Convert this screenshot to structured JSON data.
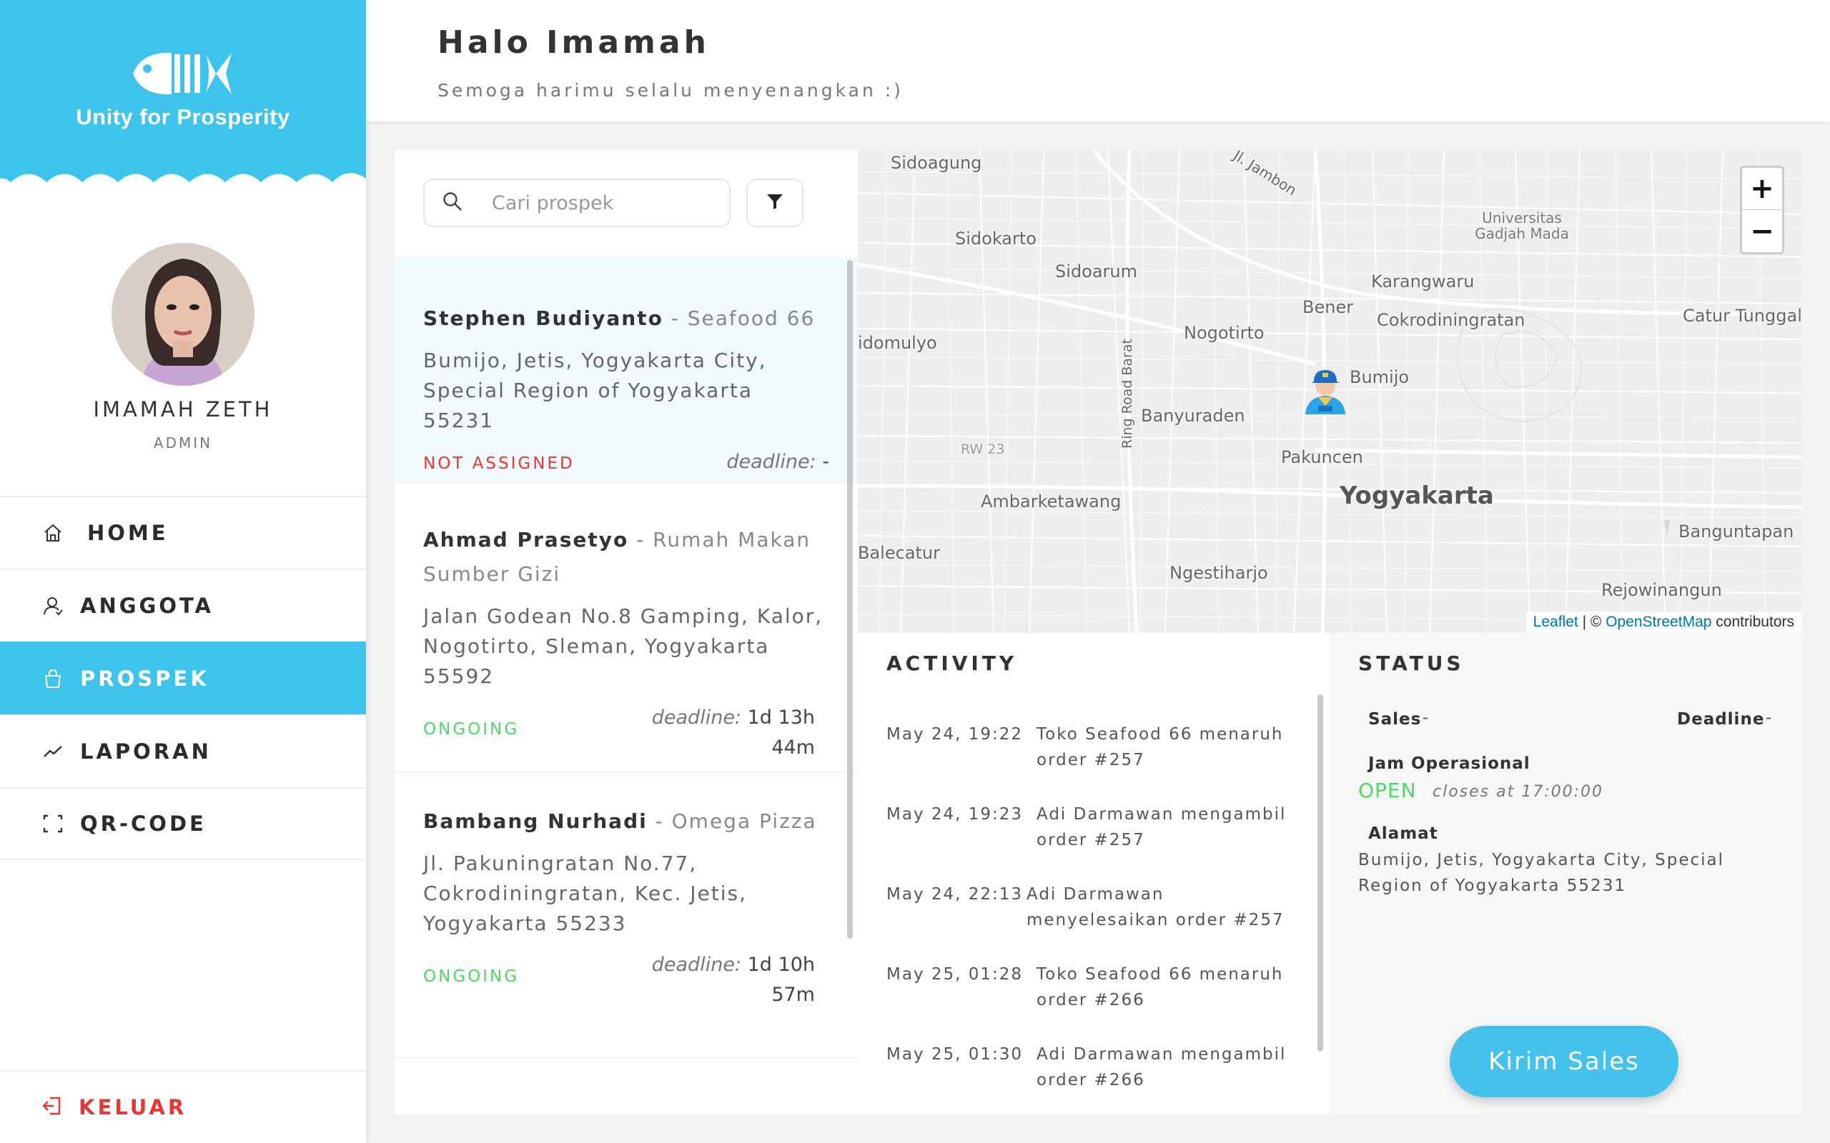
{
  "brand": {
    "name": "Unity for Prosperity",
    "logo_icon": "fish-icon",
    "color": "#3ec4ec"
  },
  "profile": {
    "name": "IMAMAH ZETH",
    "role": "ADMIN"
  },
  "nav": [
    {
      "label": "HOME",
      "icon": "home-icon",
      "active": false
    },
    {
      "label": "ANGGOTA",
      "icon": "user-icon",
      "active": false
    },
    {
      "label": "PROSPEK",
      "icon": "bag-icon",
      "active": true
    },
    {
      "label": "LAPORAN",
      "icon": "chart-icon",
      "active": false
    },
    {
      "label": "QR-CODE",
      "icon": "qr-scan-icon",
      "active": false
    }
  ],
  "logout": {
    "label": "KELUAR",
    "icon": "logout-icon",
    "color": "#e53935"
  },
  "header": {
    "greeting": "Halo Imamah",
    "subtitle": "Semoga harimu selalu menyenangkan :)"
  },
  "search": {
    "placeholder": "Cari prospek",
    "value": ""
  },
  "prospects": [
    {
      "name": "Stephen Budiyanto",
      "separator": "-",
      "business": "Seafood 66",
      "address": "Bumijo, Jetis, Yogyakarta City, Special Region of Yogyakarta 55231",
      "status": "NOT ASSIGNED",
      "deadline_label": "deadline:",
      "deadline_value": "-"
    },
    {
      "name": "Ahmad Prasetyo",
      "separator": "-",
      "business": "Rumah Makan Sumber Gizi",
      "address": "Jalan Godean No.8 Gamping, Kalor, Nogotirto, Sleman, Yogyakarta 55592",
      "status": "ONGOING",
      "deadline_label": "deadline:",
      "deadline_value": "1d 13h 44m"
    },
    {
      "name": "Bambang Nurhadi",
      "separator": "-",
      "business": "Omega Pizza",
      "address": "Jl. Pakuningratan No.77, Cokrodiningratan, Kec. Jetis, Yogyakarta 55233",
      "status": "ONGOING",
      "deadline_label": "deadline:",
      "deadline_value": "1d 10h 57m"
    }
  ],
  "map": {
    "labels": {
      "sidoagung": "Sidoagung",
      "jambon": "Jl. Jambon",
      "sidokarto": "Sidokarto",
      "sidoarum": "Sidoarum",
      "ugm": "Universitas Gadjah Mada",
      "karangwaru": "Karangwaru",
      "bener": "Bener",
      "cokrodiningratan": "Cokrodiningratan",
      "caturtunggal": "Catur Tunggal",
      "nogotirto": "Nogotirto",
      "sidomulyo": "idomulyo",
      "bumijo": "Bumijo",
      "ringroad": "Ring Road Barat",
      "banyuraden": "Banyuraden",
      "rw23": "RW 23",
      "pakuncen": "Pakuncen",
      "yogyakarta": "Yogyakarta",
      "ambarketawang": "Ambarketawang",
      "balecatur": "Balecatur",
      "banguntapan": "Banguntapan",
      "ngestiharjo": "Ngestiharjo",
      "rejowinangun": "Rejowinangun"
    },
    "zoom_in": "+",
    "zoom_out": "−",
    "attribution": {
      "leaflet": "Leaflet",
      "sep": " | © ",
      "osm": "OpenStreetMap",
      "tail": " contributors"
    },
    "marker_icon": "courier-marker-icon"
  },
  "activity": {
    "title": "ACTIVITY",
    "items": [
      {
        "time": "May 24, 19:22",
        "message": "Toko Seafood 66 menaruh order #257"
      },
      {
        "time": "May 24, 19:23",
        "message": "Adi Darmawan mengambil order #257"
      },
      {
        "time": "May 24, 22:13",
        "message": "Adi Darmawan menyelesaikan order #257"
      },
      {
        "time": "May 25, 01:28",
        "message": "Toko Seafood 66 menaruh order #266"
      },
      {
        "time": "May 25, 01:30",
        "message": "Adi Darmawan mengambil order #266"
      }
    ]
  },
  "status": {
    "title": "STATUS",
    "sales_label": "Sales",
    "sales_value": "-",
    "deadline_label": "Deadline",
    "deadline_value": "-",
    "hours_label": "Jam Operasional",
    "open_status": "OPEN",
    "closes_at": "closes at 17:00:00",
    "address_label": "Alamat",
    "address": "Bumijo, Jetis, Yogyakarta City, Special Region of Yogyakarta 55231",
    "button": "Kirim Sales"
  }
}
